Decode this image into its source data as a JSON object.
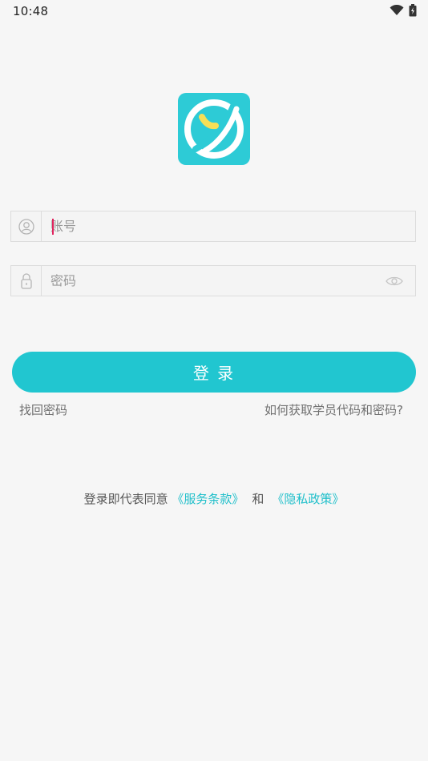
{
  "status_bar": {
    "time": "10:48"
  },
  "colors": {
    "accent": "#21c6d0",
    "link": "#1fbfca",
    "logo_bg": "#2dcbd6",
    "logo_mark": "#f7df56"
  },
  "login": {
    "account_placeholder": "账号",
    "password_placeholder": "密码",
    "button_label": "登 录",
    "forgot_password": "找回密码",
    "help_link": "如何获取学员代码和密码?"
  },
  "agreement": {
    "prefix": "登录即代表同意",
    "terms": "《服务条款》",
    "and": "和",
    "privacy": "《隐私政策》"
  },
  "icons": {
    "account": "user-icon",
    "password": "lock-icon",
    "toggle": "eye-icon"
  }
}
